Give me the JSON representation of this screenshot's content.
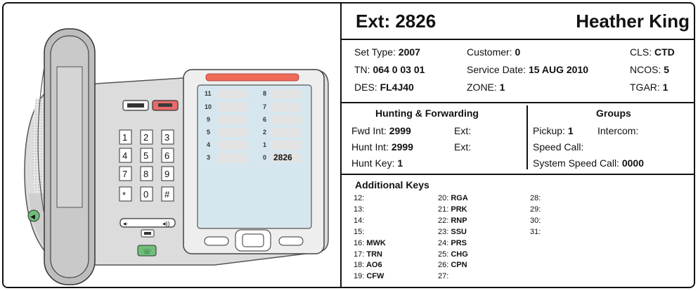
{
  "header": {
    "ext": "Ext: 2826",
    "name": "Heather King"
  },
  "set_info": {
    "set_type_label": "Set Type:",
    "set_type_value": "2007",
    "customer_label": "Customer:",
    "customer_value": "0",
    "cls_label": "CLS:",
    "cls_value": "CTD",
    "tn_label": "TN:",
    "tn_value": "064 0 03 01",
    "service_date_label": "Service Date:",
    "service_date_value": "15 AUG 2010",
    "ncos_label": "NCOS:",
    "ncos_value": "5",
    "des_label": "DES:",
    "des_value": "FL4J40",
    "zone_label": "ZONE:",
    "zone_value": "1",
    "tgar_label": "TGAR:",
    "tgar_value": "1"
  },
  "hunting": {
    "title": "Hunting & Forwarding",
    "fwd_label": "Fwd  Int:",
    "fwd_value": "2999",
    "fwd_ext_label": "Ext:",
    "hunt_label": "Hunt Int:",
    "hunt_value": "2999",
    "hunt_ext_label": "Ext:",
    "hunt_key_label": "Hunt Key:",
    "hunt_key_value": "1"
  },
  "groups": {
    "title": "Groups",
    "pickup_label": "Pickup:",
    "pickup_value": "1",
    "intercom_label": "Intercom:",
    "speed_call_label": "Speed Call:",
    "system_speed_label": "System Speed Call:",
    "system_speed_value": "0000"
  },
  "additional_keys": {
    "title": "Additional Keys",
    "keys": [
      {
        "num": "12:",
        "val": ""
      },
      {
        "num": "13:",
        "val": ""
      },
      {
        "num": "14:",
        "val": ""
      },
      {
        "num": "15:",
        "val": ""
      },
      {
        "num": "16:",
        "val": "MWK"
      },
      {
        "num": "17:",
        "val": "TRN"
      },
      {
        "num": "18:",
        "val": "AO6"
      },
      {
        "num": "19:",
        "val": "CFW"
      },
      {
        "num": "20:",
        "val": "RGA"
      },
      {
        "num": "21:",
        "val": "PRK"
      },
      {
        "num": "22:",
        "val": "RNP"
      },
      {
        "num": "23:",
        "val": "SSU"
      },
      {
        "num": "24:",
        "val": "PRS"
      },
      {
        "num": "25:",
        "val": "CHG"
      },
      {
        "num": "26:",
        "val": "CPN"
      },
      {
        "num": "27:",
        "val": ""
      },
      {
        "num": "28:",
        "val": ""
      },
      {
        "num": "29:",
        "val": ""
      },
      {
        "num": "30:",
        "val": ""
      },
      {
        "num": "31:",
        "val": ""
      }
    ]
  },
  "phone": {
    "keypad": [
      "1",
      "2",
      "3",
      "4",
      "5",
      "6",
      "7",
      "8",
      "9",
      "*",
      "0",
      "#"
    ],
    "line_keys_left": [
      "11",
      "10",
      "9",
      "5",
      "4",
      "3"
    ],
    "line_keys_right": [
      "8",
      "7",
      "6",
      "2",
      "1",
      "0"
    ],
    "display_dn": "2826",
    "colors": {
      "release_red": "#e86a6a",
      "goodbye_green": "#6fbf7a",
      "body_gray": "#bdbdbd",
      "screen_blue": "#d6e6ee"
    }
  }
}
